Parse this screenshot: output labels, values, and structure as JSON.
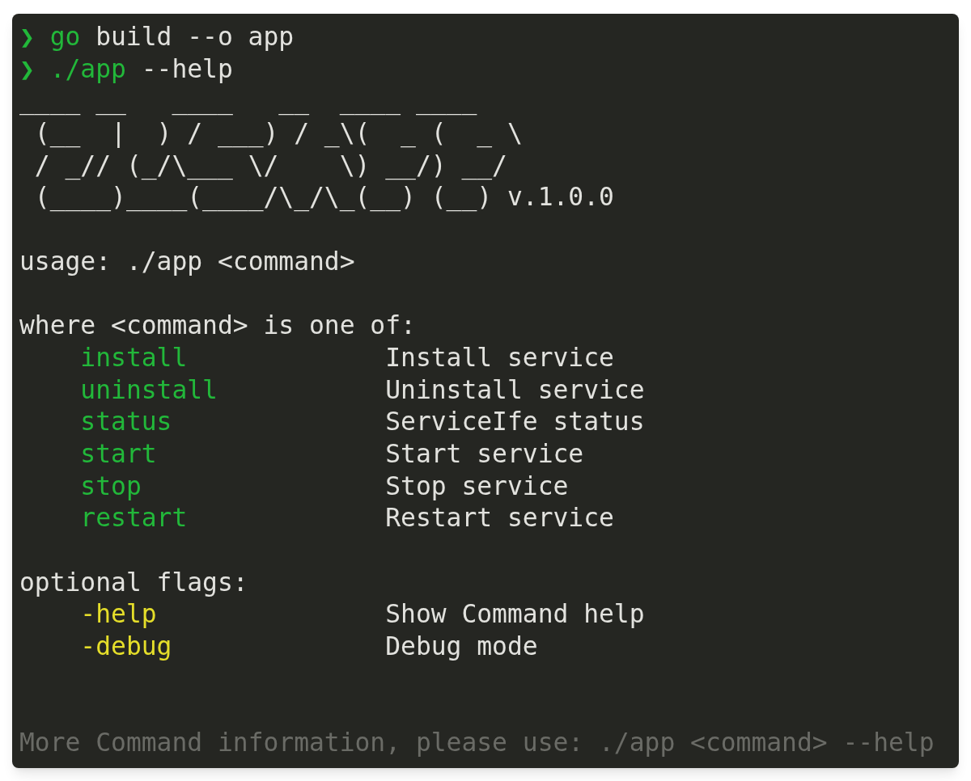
{
  "prompts": [
    {
      "symbol": "❯",
      "command": "go",
      "args": "build --o app"
    },
    {
      "symbol": "❯",
      "command": "./app",
      "args": "--help"
    }
  ],
  "banner": {
    "lines": [
      "____ __   ____   __  ____ ____",
      " (__  |  ) / ___) / _\\(  _ (  _ \\",
      " / _// (_/\\___ \\/    \\) __/) __/",
      " (____)____(____/\\_/\\_(__) (__)"
    ],
    "version": "v.1.0.0"
  },
  "usage": "usage: ./app <command>",
  "commands_heading": "where <command> is one of:",
  "commands": [
    {
      "name": "install",
      "description": "Install service"
    },
    {
      "name": "uninstall",
      "description": "Uninstall service"
    },
    {
      "name": "status",
      "description": "ServiceIfe status"
    },
    {
      "name": "start",
      "description": "Start service"
    },
    {
      "name": "stop",
      "description": "Stop service"
    },
    {
      "name": "restart",
      "description": "Restart service"
    }
  ],
  "flags_heading": "optional flags:",
  "flags": [
    {
      "name": "-help",
      "description": "Show Command help"
    },
    {
      "name": "-debug",
      "description": "Debug mode"
    }
  ],
  "footer": "More Command information, please use: ./app <command> --help"
}
